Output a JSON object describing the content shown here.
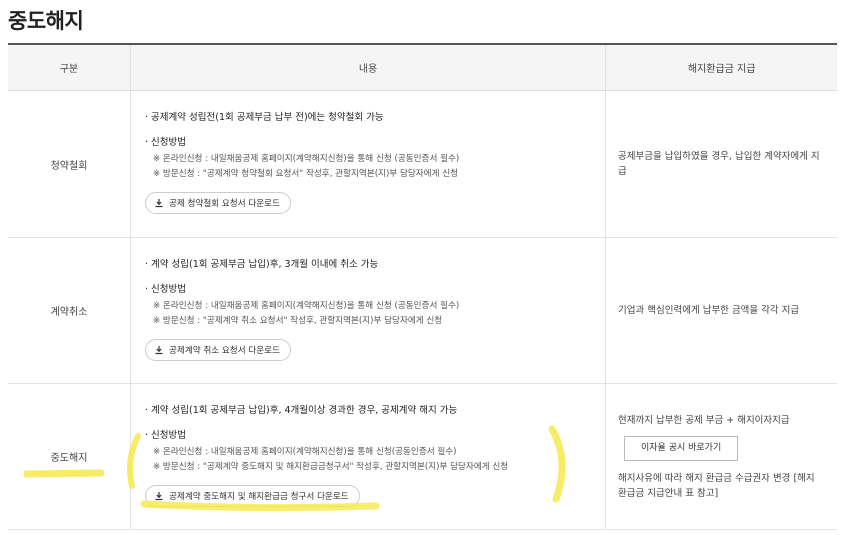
{
  "title": "중도해지",
  "headers": {
    "category": "구분",
    "content": "내용",
    "payment": "해지환급금 지급"
  },
  "rows": [
    {
      "category": "청약철회",
      "lead": "공제계약 성립전(1회 공제부금 납부 전)에는 청약철회 가능",
      "method_title": "신청방법",
      "notes": [
        "※ 온라인신청 : 내일채움공제 홈페이지(계약해지신청)을 통해 신청 (공동인증서 필수)",
        "※ 방문신청 : \"공제계약 청약철회 요청서\" 작성후, 관할지역본(지)부 담당자에게 신청"
      ],
      "button": "공제 청약철회 요청서 다운로드",
      "payment": "공제부금을 납입하였을 경우, 납입한 계약자에게 지급"
    },
    {
      "category": "계약취소",
      "lead": "계약 성립(1회 공제부금 납입)후, 3개월 이내에 취소 가능",
      "method_title": "신청방법",
      "notes": [
        "※ 온라인신청 : 내일채움공제 홈페이지(계약해지신청)을 통해 신청 (공동인증서 필수)",
        "※ 방문신청 : \"공제계약 취소 요청서\" 작성후, 관할지역본(지)부 담당자에게 신청"
      ],
      "button": "공제계약 취소 요청서 다운로드",
      "payment": "기업과 핵심인력에게 납부한 금액을 각각 지급"
    },
    {
      "category": "중도해지",
      "lead": "계약 성립(1회 공제부금 납입)후, 4개월이상 경과한 경우, 공제계약 해지 가능",
      "method_title": "신청방법",
      "notes": [
        "※ 온라인신청 : 내일채움공제 홈페이지(계약해지신청)을 통해 신청(공동인증서 필수)",
        "※ 방문신청 : \"공제계약 중도해지 및 해지환급금청구서\" 작성후, 관할지역본(지)부 담당자에게 신청"
      ],
      "button": "공제계약 중도해지 및 해지환급금 청구서 다운로드",
      "payment": "현재까지 납부한 공제 부금 + 해지이자지급",
      "rate_button": "이자율 공시 바로가기",
      "payment_note": "해지사유에 따라 해지 환급금 수급권자 변경 [해지환급금 지급안내 표 참고]"
    }
  ],
  "highlight_color": "#f7e84a"
}
